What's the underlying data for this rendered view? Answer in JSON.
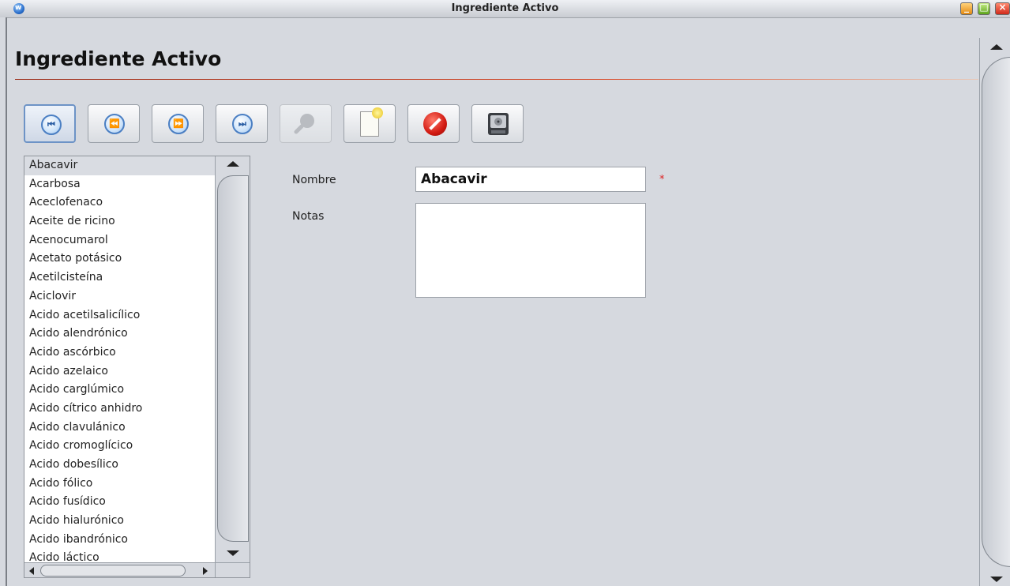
{
  "window": {
    "title": "Ingrediente Activo"
  },
  "page": {
    "heading": "Ingrediente Activo"
  },
  "toolbar": {
    "first_icon": "⏮",
    "prev_icon": "⏪",
    "next_icon": "⏩",
    "last_icon": "⏭"
  },
  "list": {
    "selected_index": 0,
    "items": [
      "Abacavir",
      "Acarbosa",
      "Aceclofenaco",
      "Aceite de ricino",
      "Acenocumarol",
      "Acetato potásico",
      "Acetilcisteína",
      "Aciclovir",
      "Acido acetilsalicílico",
      "Acido alendrónico",
      "Acido ascórbico",
      "Acido azelaico",
      "Acido carglúmico",
      "Acido cítrico anhidro",
      "Acido clavulánico",
      "Acido cromoglícico",
      "Acido dobesílico",
      "Acido fólico",
      "Acido fusídico",
      "Acido hialurónico",
      "Acido ibandrónico",
      "Acido láctico"
    ]
  },
  "form": {
    "nombre_label": "Nombre",
    "nombre_value": "Abacavir",
    "required_marker": "*",
    "notas_label": "Notas",
    "notas_value": ""
  },
  "colors": {
    "background": "#d6d9df",
    "accent_rule": "#d84b2a",
    "required": "#dd2222"
  }
}
